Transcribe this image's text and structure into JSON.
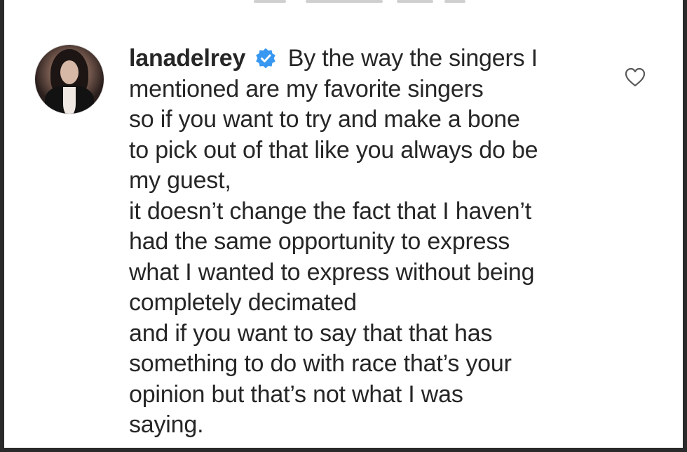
{
  "comment": {
    "username": "lanadelrey",
    "verified_icon": "verified-badge-icon",
    "lines": [
      "By the way the singers I",
      "mentioned are my favorite singers",
      "so if you want to try and make a bone",
      "to pick out of that like you always do be",
      "my guest,",
      "it doesn’t change the fact that I haven’t",
      "had the same opportunity to express",
      "what I wanted to express without being",
      "completely decimated",
      "and if you want to say that that has",
      "something to do with race that’s your",
      "opinion but that’s not what I was",
      "saying."
    ],
    "like_icon": "heart-icon",
    "badge_color": "#3897f0"
  }
}
